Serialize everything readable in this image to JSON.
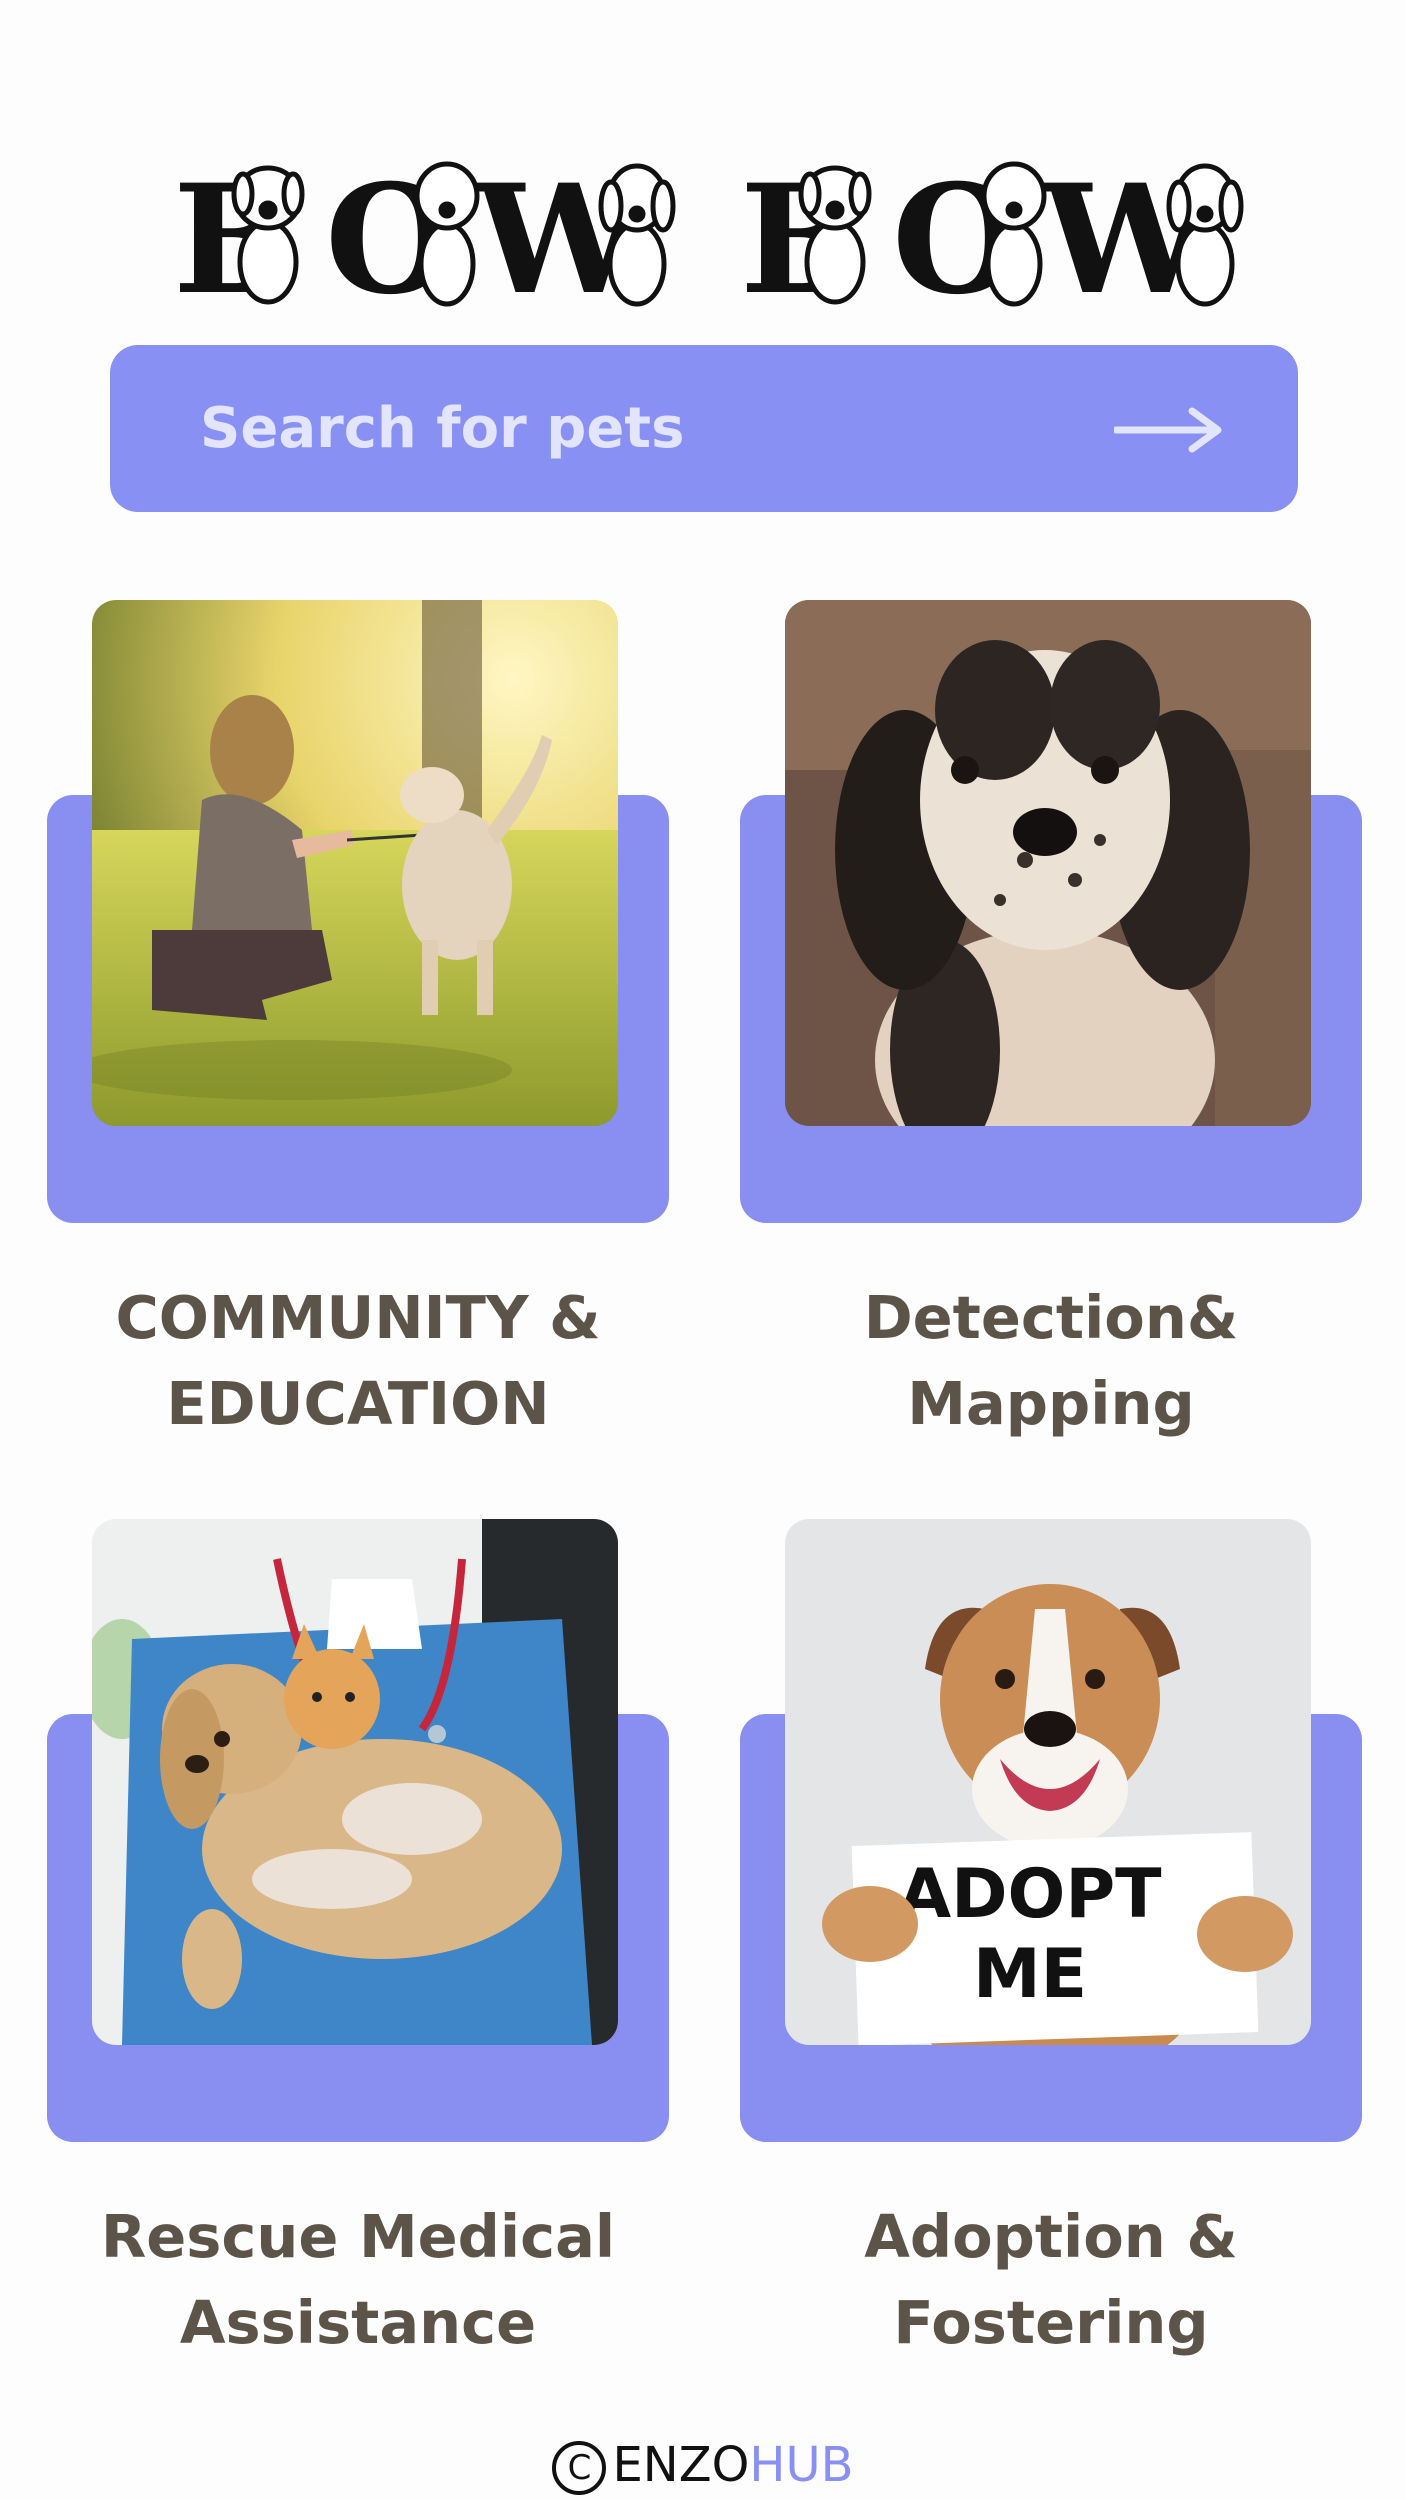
{
  "app": {
    "logo_text": "BOW BOW"
  },
  "search": {
    "placeholder": "Search for pets"
  },
  "cards": [
    {
      "line1": "COMMUNITY &",
      "line2": "EDUCATION"
    },
    {
      "line1": "Detection&",
      "line2": "Mapping"
    },
    {
      "line1": "Rescue Medical",
      "line2": "Assistance"
    },
    {
      "line1": "Adoption &",
      "line2": "Fostering"
    }
  ],
  "adopt_sign": {
    "line1": "ADOPT",
    "line2": "ME"
  },
  "footer": {
    "copyright_symbol": "C",
    "brand_part1": "ENZO",
    "brand_part2": "HUB"
  },
  "colors": {
    "accent": "#8890f3",
    "card_panel": "#888ff1",
    "label_text": "#5d5449"
  },
  "icons": {
    "search_submit": "arrow-right-icon",
    "footer": "copyright-icon"
  }
}
